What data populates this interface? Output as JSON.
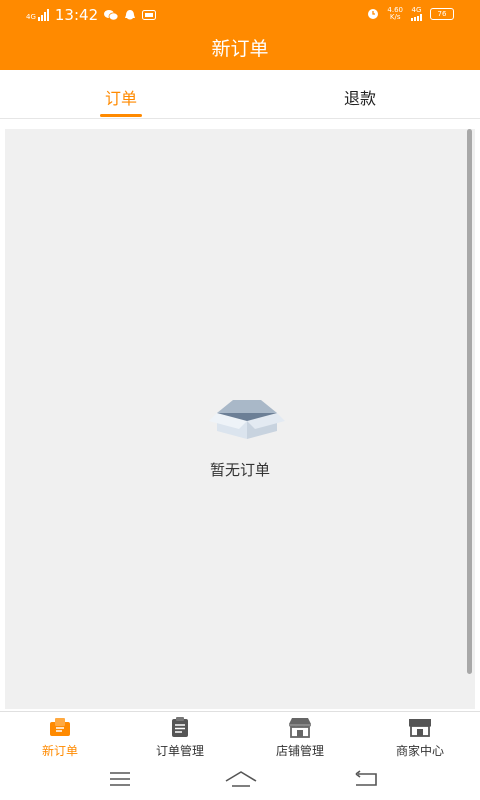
{
  "status_bar": {
    "network": "4G",
    "time": "13:42",
    "speed": "4.60",
    "speed_unit": "K/s",
    "network_right": "4G",
    "battery": "76"
  },
  "header": {
    "title": "新订单"
  },
  "tabs": [
    {
      "label": "订单",
      "active": true
    },
    {
      "label": "退款",
      "active": false
    }
  ],
  "empty_state": {
    "message": "暂无订单",
    "icon": "empty-box-icon"
  },
  "bottom_nav": [
    {
      "label": "新订单",
      "icon": "new-order-icon",
      "active": true
    },
    {
      "label": "订单管理",
      "icon": "clipboard-icon",
      "active": false
    },
    {
      "label": "店铺管理",
      "icon": "store-icon",
      "active": false
    },
    {
      "label": "商家中心",
      "icon": "merchant-icon",
      "active": false
    }
  ],
  "colors": {
    "accent": "#ff8a00",
    "background": "#f0f0f0"
  }
}
